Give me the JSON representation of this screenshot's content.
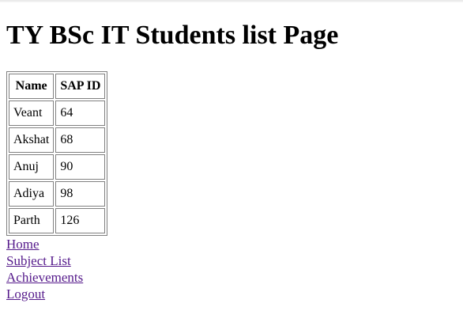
{
  "page": {
    "title": "TY BSc IT Students list Page"
  },
  "table": {
    "headers": [
      "Name",
      "SAP ID"
    ],
    "rows": [
      {
        "name": "Veant",
        "sap_id": "64"
      },
      {
        "name": "Akshat",
        "sap_id": "68"
      },
      {
        "name": "Anuj",
        "sap_id": "90"
      },
      {
        "name": "Adiya",
        "sap_id": "98"
      },
      {
        "name": "Parth",
        "sap_id": "126"
      }
    ]
  },
  "links": {
    "home": "Home",
    "subject_list": "Subject List",
    "achievements": "Achievements",
    "logout": "Logout"
  },
  "colors": {
    "visited_link": "#551a8b",
    "table_border": "#808080"
  }
}
